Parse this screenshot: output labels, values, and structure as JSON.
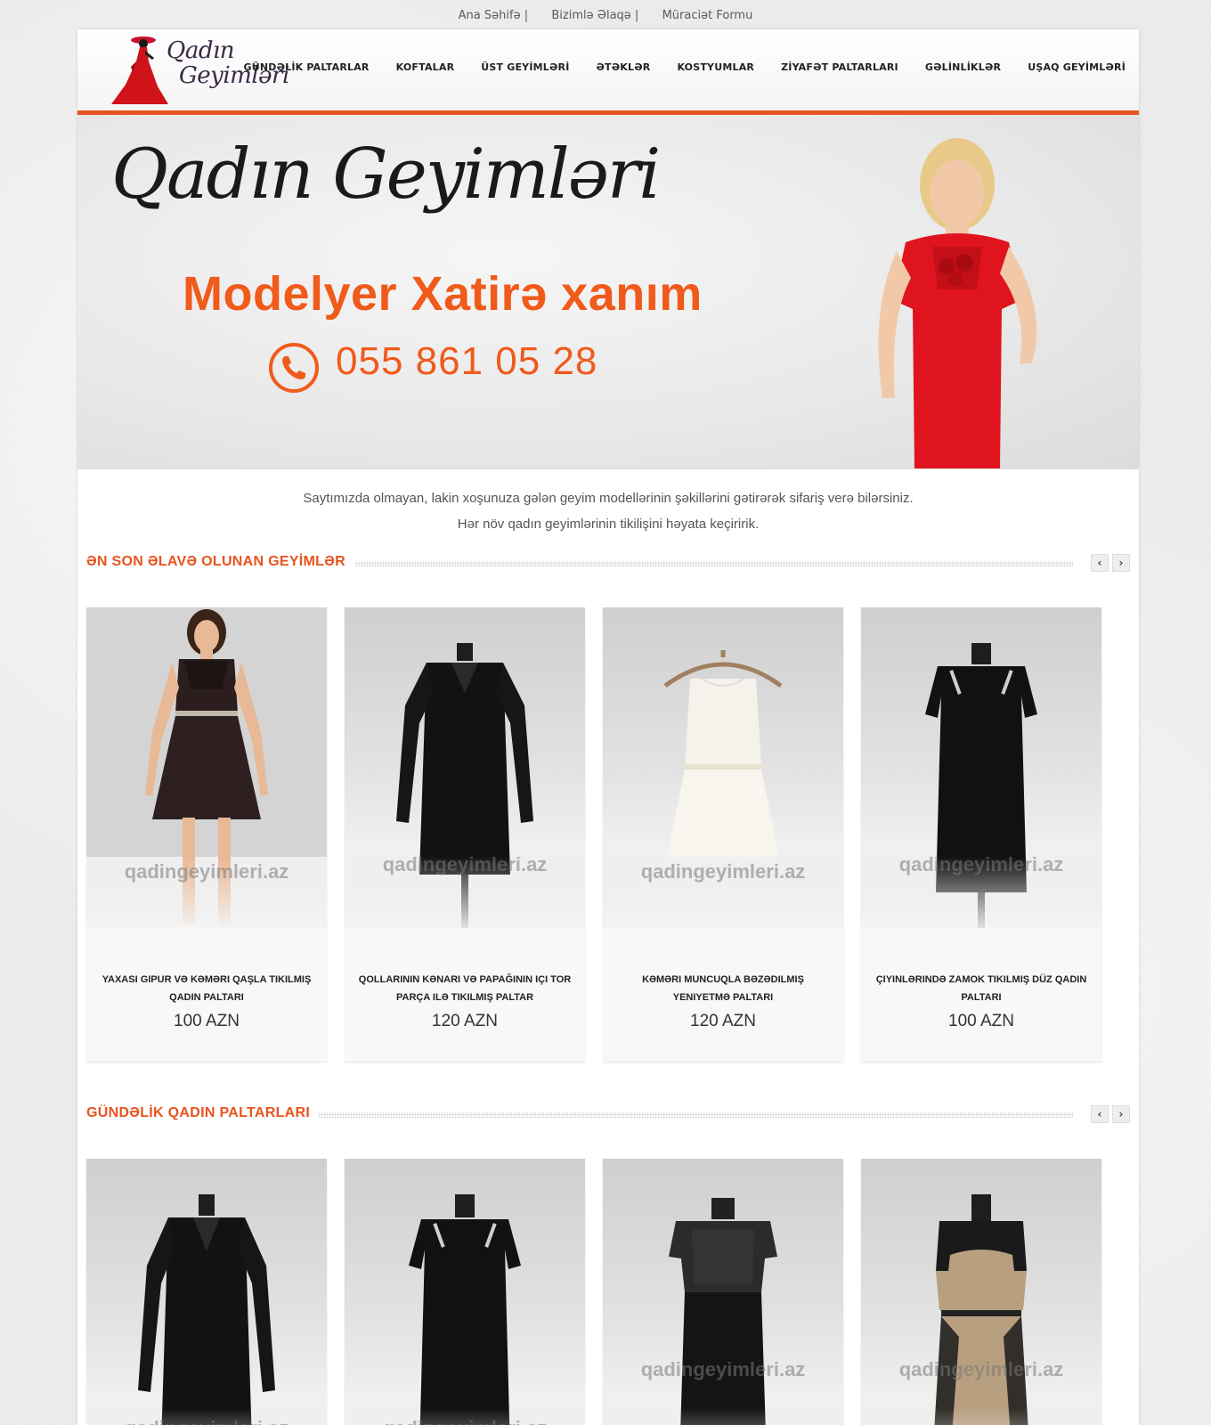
{
  "toplinks": [
    {
      "label": "Ana Səhifə |"
    },
    {
      "label": "Bizimlə Əlaqə |"
    },
    {
      "label": "Müraciət Formu"
    }
  ],
  "logo": {
    "line1": "Qadın",
    "line2": "Geyimləri"
  },
  "nav": [
    {
      "label": "GÜNDƏLİK PALTARLAR"
    },
    {
      "label": "KOFTALAR"
    },
    {
      "label": "ÜST GEYİMLƏRİ"
    },
    {
      "label": "ƏTƏKLƏR"
    },
    {
      "label": "KOSTYUMLAR"
    },
    {
      "label": "ZİYAFƏT PALTARLARI"
    },
    {
      "label": "GƏLİNLİKLƏR"
    },
    {
      "label": "UŞAQ GEYİMLƏRİ"
    }
  ],
  "banner": {
    "title": "Qadın Geyimləri",
    "subtitle": "Modelyer Xatirə xanım",
    "phone": "055 861 05 28"
  },
  "intro": {
    "line1": "Saytımızda olmayan, lakin xoşunuza gələn geyim modellərinin şəkillərini gətirərək sifariş verə bilərsiniz.",
    "line2": "Hər növ qadın geyimlərinin tikilişini həyata keçiririk."
  },
  "colors": {
    "accent": "#e8541e"
  },
  "sections": [
    {
      "title": "ƏN SON ƏLAVƏ OLUNAN GEYİMLƏR",
      "arrows": {
        "prev": "‹",
        "next": "›"
      },
      "products": [
        {
          "title": "YAXASI GIPUR VƏ KƏMƏRI QAŞLA TIKILMIŞ QADIN PALTARI",
          "price": "100 AZN",
          "watermark": "qadingeyimleri.az"
        },
        {
          "title": "QOLLARININ KƏNARI VƏ PAPAĞININ IÇI TOR PARÇA ILƏ TIKILMIŞ PALTAR",
          "price": "120 AZN",
          "watermark": "qadingeyimleri.az"
        },
        {
          "title": "KƏMƏRI MUNCUQLA BƏZƏDILMIŞ YENIYETMƏ PALTARI",
          "price": "120 AZN",
          "watermark": "qadingeyimleri.az"
        },
        {
          "title": "ÇIYINLƏRINDƏ ZAMOK TIKILMIŞ DÜZ QADIN PALTARI",
          "price": "100 AZN",
          "watermark": "qadingeyimleri.az"
        }
      ]
    },
    {
      "title": "GÜNDƏLİK QADIN PALTARLARI",
      "arrows": {
        "prev": "‹",
        "next": "›"
      },
      "products": [
        {
          "watermark": "qadingeyimleri.az"
        },
        {
          "watermark": "qadingeyimleri.az"
        },
        {
          "watermark": "qadingeyimleri.az"
        },
        {
          "watermark": "qadingeyimleri.az"
        }
      ]
    }
  ]
}
